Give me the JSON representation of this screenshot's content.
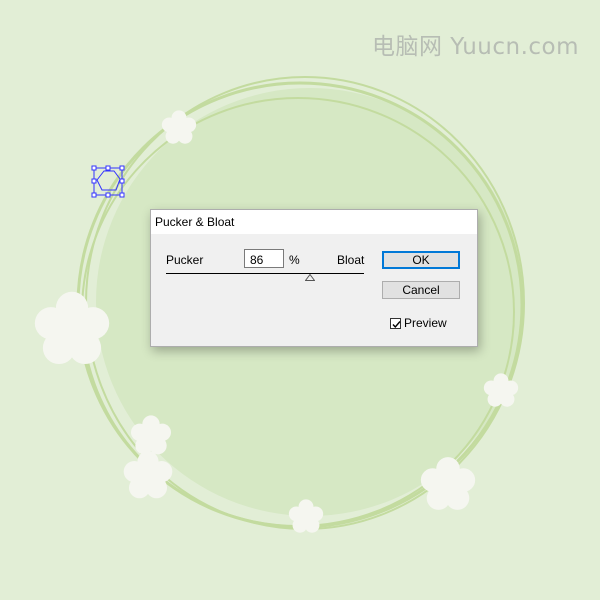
{
  "watermark": "电脑网 Yuucn.com",
  "dialog": {
    "title": "Pucker & Bloat",
    "pucker_label": "Pucker",
    "bloat_label": "Bloat",
    "amount": "86",
    "unit": "%",
    "ok_label": "OK",
    "cancel_label": "Cancel",
    "preview_label": "Preview",
    "preview_checked": true
  },
  "colors": {
    "background": "#e2eed6",
    "disc": "#d6e8c4",
    "ring": "#c3db9f",
    "flower": "#f5f6f0",
    "selection": "#3333ff",
    "ok_border": "#0078d7"
  },
  "icons": {
    "flower": "flower-icon",
    "checkbox": "checkmark-icon",
    "slider": "triangle-thumb-icon"
  }
}
